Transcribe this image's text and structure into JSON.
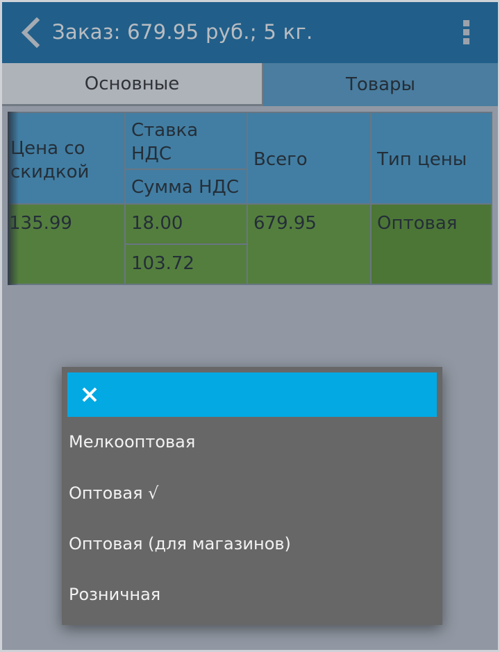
{
  "header": {
    "title": "Заказ: 679.95 руб.; 5 кг.",
    "back_icon": "chevron-left-icon",
    "menu_icon": "more-vert-icon"
  },
  "tabs": [
    {
      "label": "Основные",
      "active": true
    },
    {
      "label": "Товары",
      "active": false
    }
  ],
  "table": {
    "headers": {
      "price_discount": "Цена со скидкой",
      "price_discount_line1": "Цена со",
      "price_discount_line2": "скидкой",
      "vat_rate": "Ставка НДС",
      "vat_rate_line1": "Ставка",
      "vat_rate_line2": "НДС",
      "vat_sum": "Сумма НДС",
      "total": "Всего",
      "price_type": "Тип цены"
    },
    "rows": [
      {
        "price_discount": "135.99",
        "vat_rate": "18.00",
        "vat_sum": "103.72",
        "total": "679.95",
        "price_type": "Оптовая"
      }
    ]
  },
  "price_type_dialog": {
    "close_icon": "close-icon",
    "options": [
      "Мелкооптовая",
      "Оптовая √",
      "Оптовая (для магазинов)",
      "Розничная"
    ]
  },
  "colors": {
    "app_bar": "#0b6aa6",
    "table_header": "#3f9bcf",
    "table_row": "#5c9b2c",
    "dialog_header": "#02a9e3",
    "dialog_body": "#676767"
  }
}
